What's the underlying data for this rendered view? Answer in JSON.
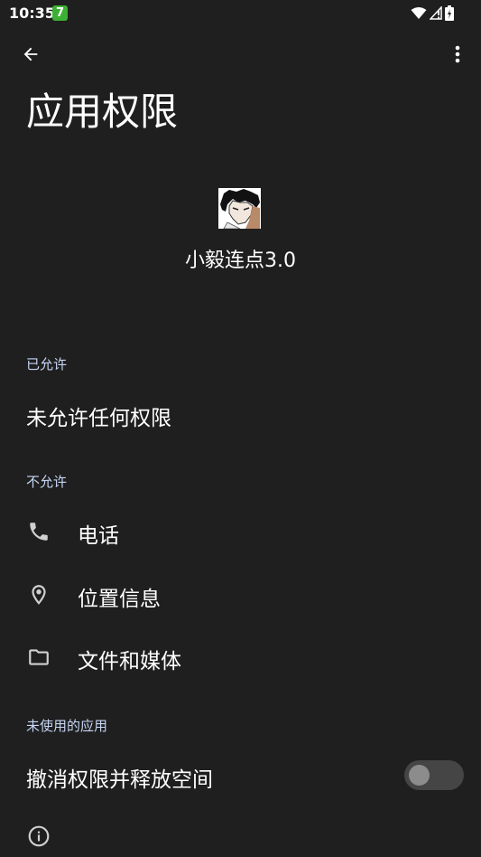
{
  "status_bar": {
    "time": "10:35",
    "badge": "7",
    "icons": [
      "wifi-icon",
      "signal-icon",
      "battery-icon"
    ]
  },
  "toolbar": {
    "back_icon": "arrow-back-icon",
    "more_icon": "more-vert-icon"
  },
  "page": {
    "title": "应用权限"
  },
  "app": {
    "icon": "app-avatar-icon",
    "name": "小毅连点3.0"
  },
  "allowed": {
    "header": "已允许",
    "empty_text": "未允许任何权限"
  },
  "denied": {
    "header": "不允许",
    "items": [
      {
        "label": "电话",
        "icon": "phone-icon"
      },
      {
        "label": "位置信息",
        "icon": "location-icon"
      },
      {
        "label": "文件和媒体",
        "icon": "folder-icon"
      }
    ]
  },
  "unused": {
    "header": "未使用的应用",
    "toggle_label": "撤消权限并释放空间",
    "toggle_on": false,
    "info_icon": "info-icon"
  }
}
